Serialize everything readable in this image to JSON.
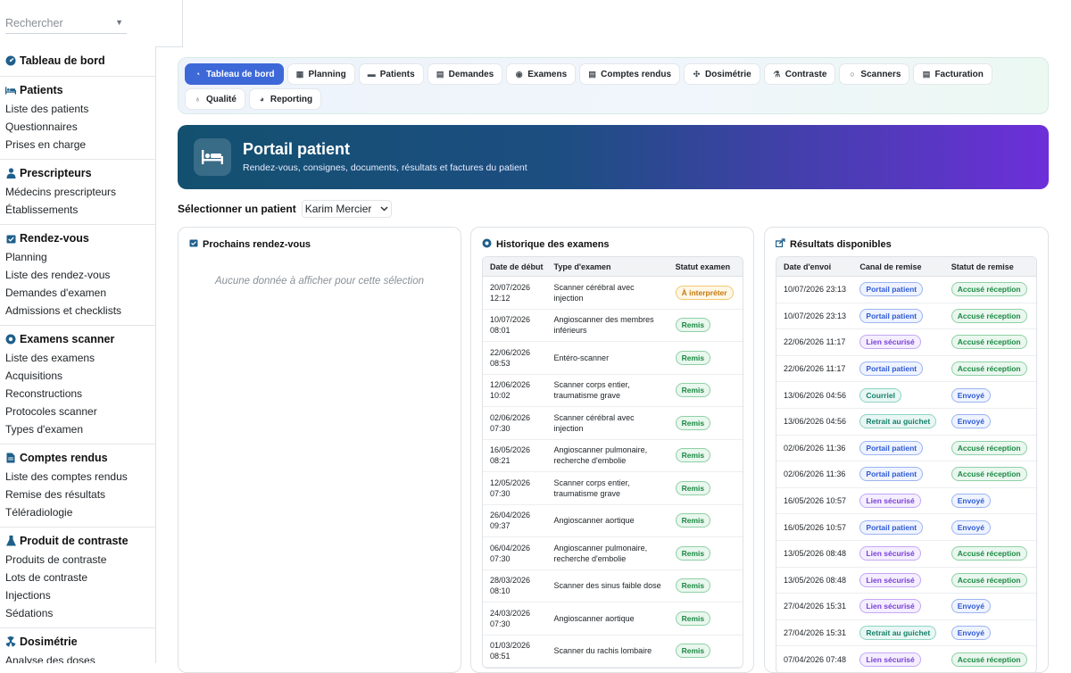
{
  "sidebar": {
    "search_placeholder": "Rechercher",
    "dashboard": "Tableau de bord",
    "sections": [
      {
        "title": "Patients",
        "icon": "bed-icon",
        "items": [
          "Liste des patients",
          "Questionnaires",
          "Prises en charge"
        ]
      },
      {
        "title": "Prescripteurs",
        "icon": "doctor-icon",
        "items": [
          "Médecins prescripteurs",
          "Établissements"
        ]
      },
      {
        "title": "Rendez-vous",
        "icon": "calendar-check-icon",
        "items": [
          "Planning",
          "Liste des rendez-vous",
          "Demandes d'examen",
          "Admissions et checklists"
        ]
      },
      {
        "title": "Examens scanner",
        "icon": "scanner-icon",
        "items": [
          "Liste des examens",
          "Acquisitions",
          "Reconstructions",
          "Protocoles scanner",
          "Types d'examen"
        ]
      },
      {
        "title": "Comptes rendus",
        "icon": "document-icon",
        "items": [
          "Liste des comptes rendus",
          "Remise des résultats",
          "Téléradiologie"
        ]
      },
      {
        "title": "Produit de contraste",
        "icon": "flask-icon",
        "items": [
          "Produits de contraste",
          "Lots de contraste",
          "Injections",
          "Sédations"
        ]
      },
      {
        "title": "Dosimétrie",
        "icon": "radiation-icon",
        "items": [
          "Analyse des doses"
        ]
      }
    ]
  },
  "tabs": [
    {
      "label": "Tableau de bord",
      "icon": "dashboard-icon",
      "glyph": "◔",
      "active": true
    },
    {
      "label": "Planning",
      "icon": "calendar-icon",
      "glyph": "▦",
      "active": false
    },
    {
      "label": "Patients",
      "icon": "bed-icon",
      "glyph": "▬",
      "active": false
    },
    {
      "label": "Demandes",
      "icon": "file-icon",
      "glyph": "▤",
      "active": false
    },
    {
      "label": "Examens",
      "icon": "scanner-icon",
      "glyph": "◉",
      "active": false
    },
    {
      "label": "Comptes rendus",
      "icon": "document-icon",
      "glyph": "▤",
      "active": false
    },
    {
      "label": "Dosimétrie",
      "icon": "radiation-icon",
      "glyph": "✣",
      "active": false
    },
    {
      "label": "Contraste",
      "icon": "flask-icon",
      "glyph": "⚗",
      "active": false
    },
    {
      "label": "Scanners",
      "icon": "circle-icon",
      "glyph": "○",
      "active": false
    },
    {
      "label": "Facturation",
      "icon": "invoice-icon",
      "glyph": "▤",
      "active": false
    },
    {
      "label": "Qualité",
      "icon": "award-icon",
      "glyph": "♁",
      "active": false
    },
    {
      "label": "Reporting",
      "icon": "pie-chart-icon",
      "glyph": "◕",
      "active": false
    }
  ],
  "hero": {
    "title": "Portail patient",
    "subtitle": "Rendez-vous, consignes, documents, résultats et factures du patient"
  },
  "patient_select": {
    "label": "Sélectionner un patient",
    "value": "Karim Mercier"
  },
  "upcoming": {
    "title": "Prochains rendez-vous",
    "empty": "Aucune donnée à afficher pour cette sélection"
  },
  "history": {
    "title": "Historique des examens",
    "columns": [
      "Date de début",
      "Type d'examen",
      "Statut examen"
    ],
    "rows": [
      {
        "date": "20/07/2026",
        "time": "12:12",
        "type": [
          "Scanner cérébral avec",
          "injection"
        ],
        "status": "À interpréter",
        "kind": "warn"
      },
      {
        "date": "10/07/2026",
        "time": "08:01",
        "type": [
          "Angioscanner des membres",
          "inférieurs"
        ],
        "status": "Remis",
        "kind": "ok"
      },
      {
        "date": "22/06/2026",
        "time": "08:53",
        "type": [
          "Entéro-scanner"
        ],
        "status": "Remis",
        "kind": "ok"
      },
      {
        "date": "12/06/2026",
        "time": "10:02",
        "type": [
          "Scanner corps entier,",
          "traumatisme grave"
        ],
        "status": "Remis",
        "kind": "ok"
      },
      {
        "date": "02/06/2026",
        "time": "07:30",
        "type": [
          "Scanner cérébral avec",
          "injection"
        ],
        "status": "Remis",
        "kind": "ok"
      },
      {
        "date": "16/05/2026",
        "time": "08:21",
        "type": [
          "Angioscanner pulmonaire,",
          "recherche d'embolie"
        ],
        "status": "Remis",
        "kind": "ok"
      },
      {
        "date": "12/05/2026",
        "time": "07:30",
        "type": [
          "Scanner corps entier,",
          "traumatisme grave"
        ],
        "status": "Remis",
        "kind": "ok"
      },
      {
        "date": "26/04/2026",
        "time": "09:37",
        "type": [
          "Angioscanner aortique"
        ],
        "status": "Remis",
        "kind": "ok"
      },
      {
        "date": "06/04/2026",
        "time": "07:30",
        "type": [
          "Angioscanner pulmonaire,",
          "recherche d'embolie"
        ],
        "status": "Remis",
        "kind": "ok"
      },
      {
        "date": "28/03/2026",
        "time": "08:10",
        "type": [
          "Scanner des sinus faible dose"
        ],
        "status": "Remis",
        "kind": "ok"
      },
      {
        "date": "24/03/2026",
        "time": "07:30",
        "type": [
          "Angioscanner aortique"
        ],
        "status": "Remis",
        "kind": "ok"
      },
      {
        "date": "01/03/2026",
        "time": "08:51",
        "type": [
          "Scanner du rachis lombaire"
        ],
        "status": "Remis",
        "kind": "ok"
      }
    ]
  },
  "results": {
    "title": "Résultats disponibles",
    "columns": [
      "Date d'envoi",
      "Canal de remise",
      "Statut de remise"
    ],
    "rows": [
      {
        "date": "10/07/2026 23:13",
        "channel": "Portail patient",
        "ch": "blue",
        "status": "Accusé réception",
        "st": "ok"
      },
      {
        "date": "10/07/2026 23:13",
        "channel": "Portail patient",
        "ch": "blue",
        "status": "Accusé réception",
        "st": "ok"
      },
      {
        "date": "22/06/2026 11:17",
        "channel": "Lien sécurisé",
        "ch": "purple",
        "status": "Accusé réception",
        "st": "ok"
      },
      {
        "date": "22/06/2026 11:17",
        "channel": "Portail patient",
        "ch": "blue",
        "status": "Accusé réception",
        "st": "ok"
      },
      {
        "date": "13/06/2026 04:56",
        "channel": "Courriel",
        "ch": "teal",
        "status": "Envoyé",
        "st": "blue"
      },
      {
        "date": "13/06/2026 04:56",
        "channel": "Retrait au guichet",
        "ch": "teal",
        "status": "Envoyé",
        "st": "blue"
      },
      {
        "date": "02/06/2026 11:36",
        "channel": "Portail patient",
        "ch": "blue",
        "status": "Accusé réception",
        "st": "ok"
      },
      {
        "date": "02/06/2026 11:36",
        "channel": "Portail patient",
        "ch": "blue",
        "status": "Accusé réception",
        "st": "ok"
      },
      {
        "date": "16/05/2026 10:57",
        "channel": "Lien sécurisé",
        "ch": "purple",
        "status": "Envoyé",
        "st": "blue"
      },
      {
        "date": "16/05/2026 10:57",
        "channel": "Portail patient",
        "ch": "blue",
        "status": "Envoyé",
        "st": "blue"
      },
      {
        "date": "13/05/2026 08:48",
        "channel": "Lien sécurisé",
        "ch": "purple",
        "status": "Accusé réception",
        "st": "ok"
      },
      {
        "date": "13/05/2026 08:48",
        "channel": "Lien sécurisé",
        "ch": "purple",
        "status": "Accusé réception",
        "st": "ok"
      },
      {
        "date": "27/04/2026 15:31",
        "channel": "Lien sécurisé",
        "ch": "purple",
        "status": "Envoyé",
        "st": "blue"
      },
      {
        "date": "27/04/2026 15:31",
        "channel": "Retrait au guichet",
        "ch": "teal",
        "status": "Envoyé",
        "st": "blue"
      },
      {
        "date": "07/04/2026 07:48",
        "channel": "Lien sécurisé",
        "ch": "purple",
        "status": "Accusé réception",
        "st": "ok"
      }
    ]
  },
  "colors": {
    "accent": "#3d68d8",
    "hero_start": "#13506f",
    "hero_end": "#6d2fd9",
    "sidebar_icon": "#1f5f8b"
  }
}
